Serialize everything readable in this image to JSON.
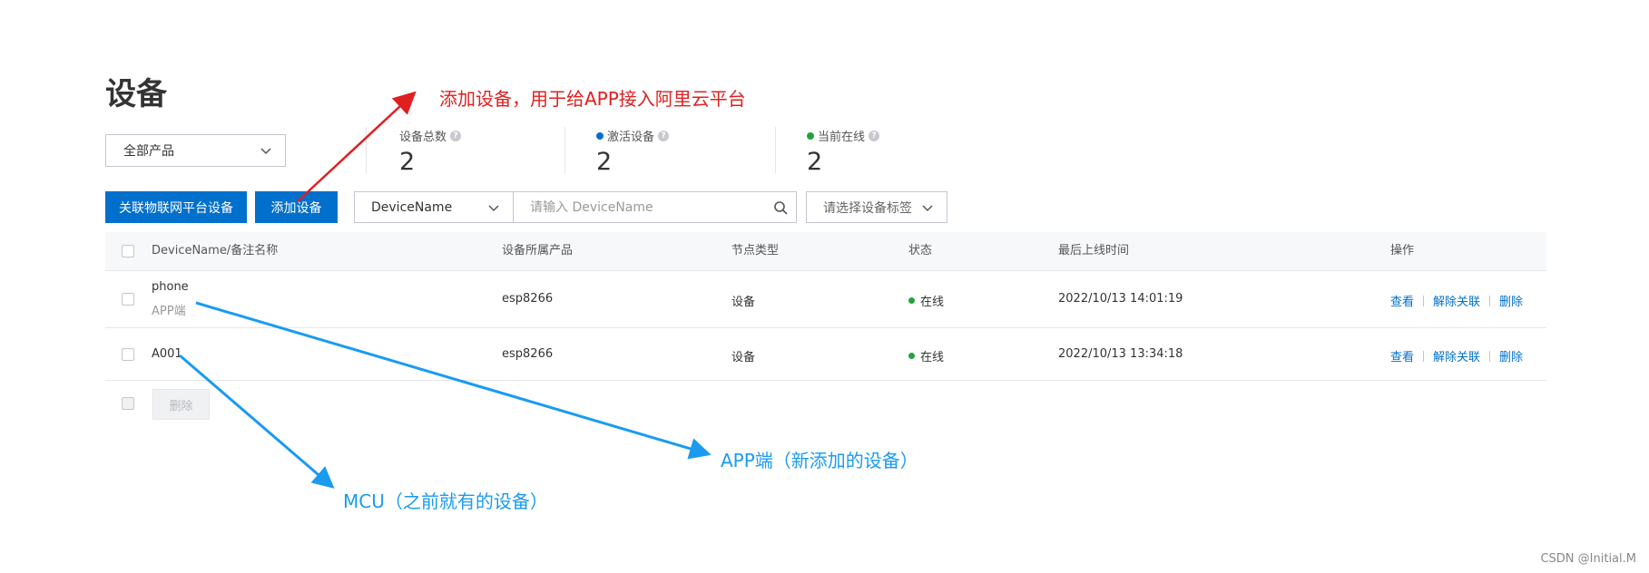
{
  "page": {
    "title": "设备"
  },
  "filters": {
    "product_select": "全部产品",
    "field_select": "DeviceName",
    "search_placeholder": "请输入 DeviceName",
    "tag_select_placeholder": "请选择设备标签"
  },
  "stats": [
    {
      "label": "设备总数",
      "value": "2",
      "dot_color": ""
    },
    {
      "label": "激活设备",
      "value": "2",
      "dot_color": "#0070cc"
    },
    {
      "label": "当前在线",
      "value": "2",
      "dot_color": "#23a33a"
    }
  ],
  "toolbar": {
    "link_platform_label": "关联物联网平台设备",
    "add_device_label": "添加设备"
  },
  "table": {
    "headers": [
      "DeviceName/备注名称",
      "设备所属产品",
      "节点类型",
      "状态",
      "最后上线时间",
      "操作"
    ],
    "rows": [
      {
        "name": "phone",
        "note": "APP端",
        "product": "esp8266",
        "node_type": "设备",
        "status": "在线",
        "last_online": "2022/10/13 14:01:19",
        "ops": [
          "查看",
          "解除关联",
          "删除"
        ]
      },
      {
        "name": "A001",
        "note": "",
        "product": "esp8266",
        "node_type": "设备",
        "status": "在线",
        "last_online": "2022/10/13 13:34:18",
        "ops": [
          "查看",
          "解除关联",
          "删除"
        ]
      }
    ],
    "bulk_delete_label": "删除"
  },
  "annotations": {
    "add_device_note": "添加设备，用于给APP接入阿里云平台",
    "app_note": "APP端（新添加的设备）",
    "mcu_note": "MCU（之前就有的设备）"
  },
  "watermark": "CSDN @Initial.M",
  "colors": {
    "primary": "#0070cc",
    "online": "#23a33a",
    "annot_red": "#e02020",
    "annot_blue": "#1a9bf0"
  },
  "icons": {
    "info": "question-mark-icon",
    "search": "search-icon",
    "dropdown": "chevron-down-icon"
  }
}
